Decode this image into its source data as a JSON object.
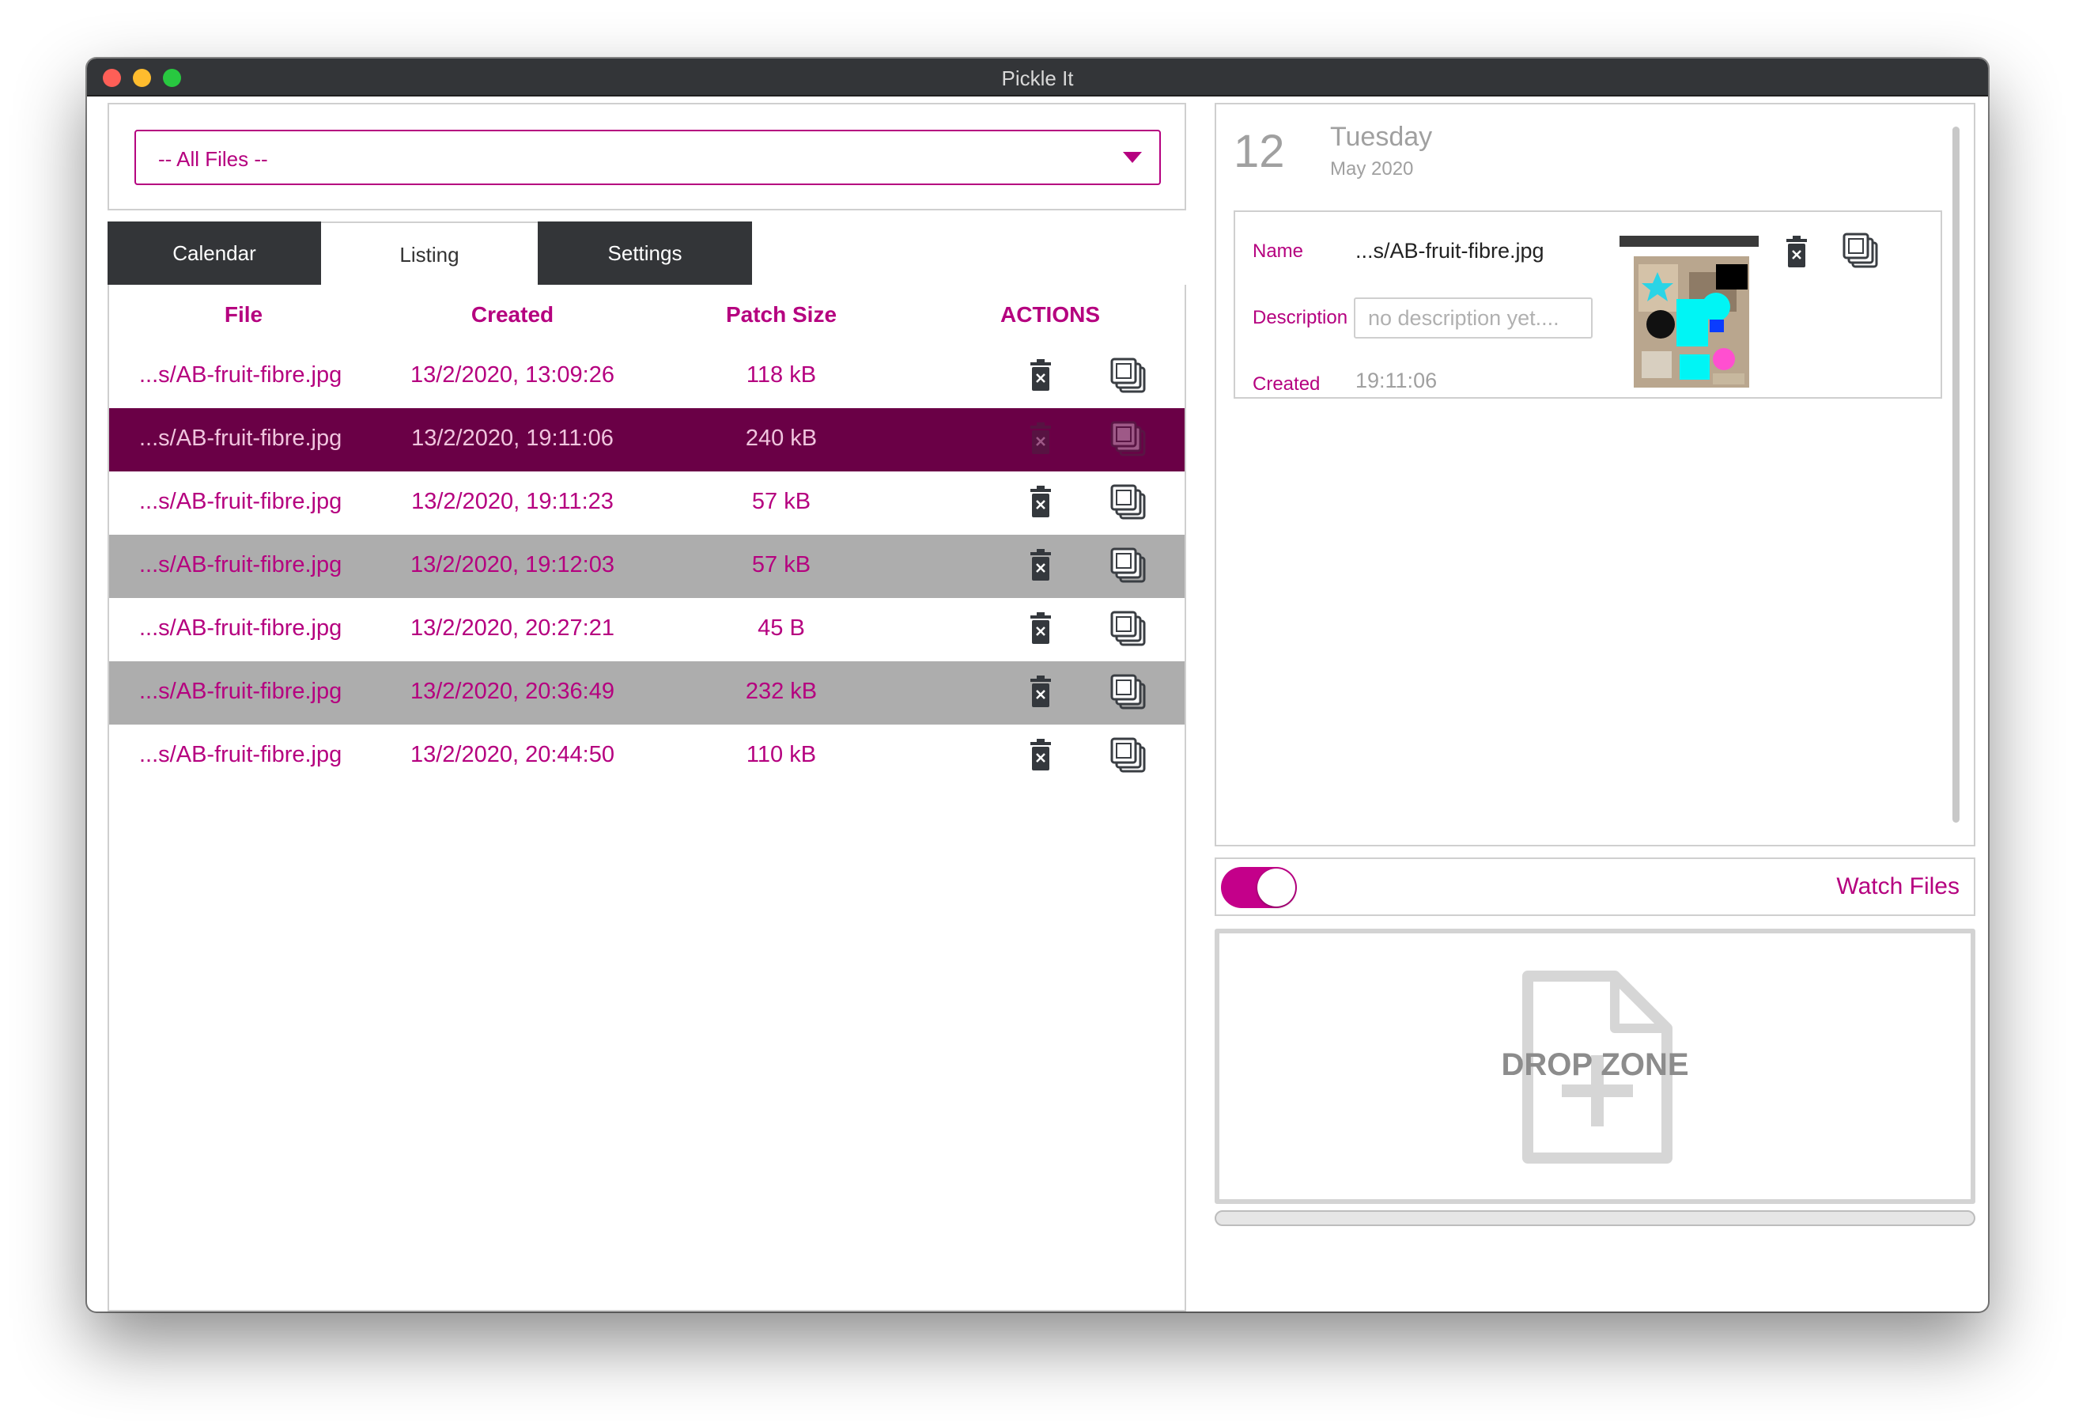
{
  "window": {
    "title": "Pickle It"
  },
  "filter": {
    "selected": "-- All Files --"
  },
  "tabs": [
    {
      "label": "Calendar",
      "active": false
    },
    {
      "label": "Listing",
      "active": true
    },
    {
      "label": "Settings",
      "active": false
    }
  ],
  "table": {
    "headers": {
      "file": "File",
      "created": "Created",
      "size": "Patch Size",
      "actions": "ACTIONS"
    },
    "rows": [
      {
        "file": "...s/AB-fruit-fibre.jpg",
        "created": "13/2/2020, 13:09:26",
        "size": "118 kB",
        "state": "normal"
      },
      {
        "file": "...s/AB-fruit-fibre.jpg",
        "created": "13/2/2020, 19:11:06",
        "size": "240 kB",
        "state": "selected"
      },
      {
        "file": "...s/AB-fruit-fibre.jpg",
        "created": "13/2/2020, 19:11:23",
        "size": "57 kB",
        "state": "normal"
      },
      {
        "file": "...s/AB-fruit-fibre.jpg",
        "created": "13/2/2020, 19:12:03",
        "size": "57 kB",
        "state": "alt"
      },
      {
        "file": "...s/AB-fruit-fibre.jpg",
        "created": "13/2/2020, 20:27:21",
        "size": "45 B",
        "state": "normal"
      },
      {
        "file": "...s/AB-fruit-fibre.jpg",
        "created": "13/2/2020, 20:36:49",
        "size": "232 kB",
        "state": "alt"
      },
      {
        "file": "...s/AB-fruit-fibre.jpg",
        "created": "13/2/2020, 20:44:50",
        "size": "110 kB",
        "state": "normal"
      }
    ],
    "action_icons": [
      "trash-icon",
      "copy-icon"
    ]
  },
  "detail": {
    "day": "12",
    "weekday": "Tuesday",
    "month_year": "May 2020",
    "name_label": "Name",
    "name_value": "...s/AB-fruit-fibre.jpg",
    "description_label": "Description",
    "description_placeholder": "no description yet....",
    "description_value": "",
    "created_label": "Created",
    "created_value": "19:11:06"
  },
  "watch": {
    "label": "Watch Files",
    "enabled": true
  },
  "drop_zone": {
    "label": "DROP ZONE"
  },
  "colors": {
    "accent": "#b5007f",
    "toggle_on": "#c4008a",
    "selected_row": "#6a0046",
    "alt_row": "#adadad",
    "tab_dark": "#333538",
    "titlebar": "#333538"
  }
}
